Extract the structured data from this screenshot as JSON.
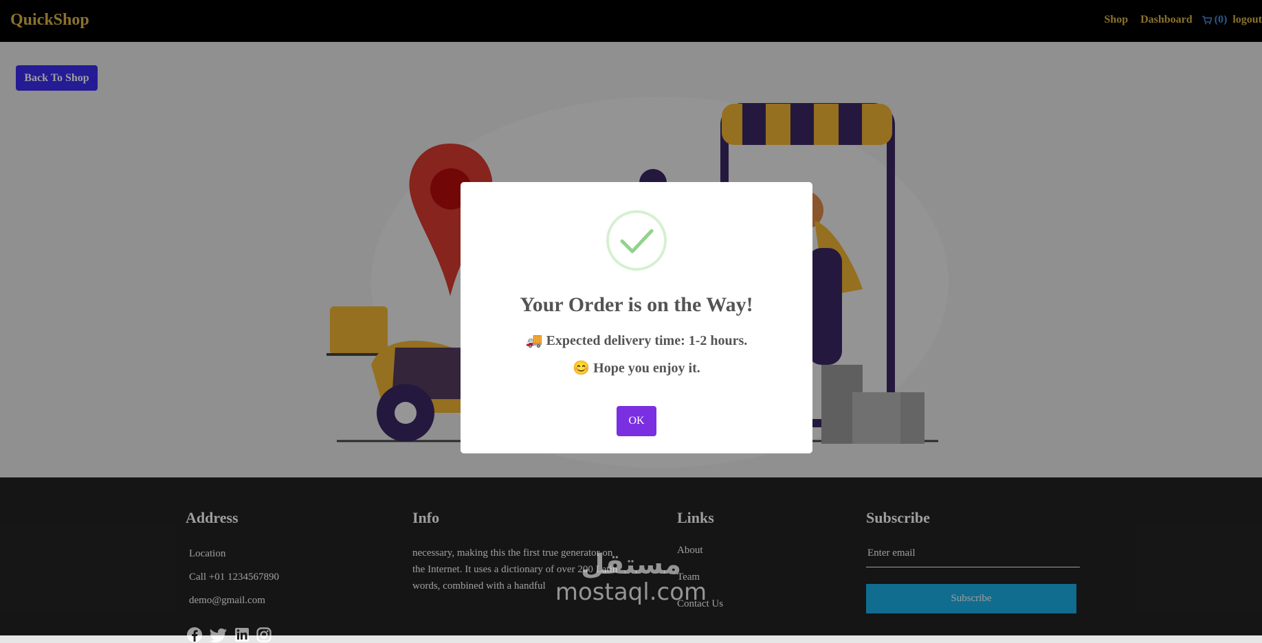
{
  "header": {
    "brand": "QuickShop",
    "nav": {
      "shop": "Shop",
      "dashboard": "Dashboard",
      "cart_count": "(0)",
      "logout": "logout"
    }
  },
  "hero": {
    "back_button": "Back To Shop"
  },
  "modal": {
    "title": "Your Order is on the Way!",
    "line1": "🚚 Expected delivery time: 1-2 hours.",
    "line2": "😊 Hope you enjoy it.",
    "ok_button": "OK"
  },
  "footer": {
    "address": {
      "heading": "Address",
      "location": "Location",
      "phone": "Call +01 1234567890",
      "email": "demo@gmail.com"
    },
    "info": {
      "heading": "Info",
      "text": "necessary, making this the first true generator on the Internet. It uses a dictionary of over 200 Latin words, combined with a handful"
    },
    "links": {
      "heading": "Links",
      "items": [
        "About",
        "Team",
        "Contact Us"
      ]
    },
    "subscribe": {
      "heading": "Subscribe",
      "placeholder": "Enter email",
      "button": "Subscribe"
    }
  },
  "watermark": {
    "arabic": "مستقل",
    "latin": "mostaql.com"
  },
  "colors": {
    "brand": "#e0b84a",
    "back_button": "#3b2df0",
    "ok_button": "#7a2fe0",
    "subscribe_button": "#1ab0e8",
    "check": "#8fd48a"
  },
  "icons": [
    "cart-icon",
    "check-icon",
    "facebook-icon",
    "twitter-icon",
    "linkedin-icon",
    "instagram-icon"
  ]
}
